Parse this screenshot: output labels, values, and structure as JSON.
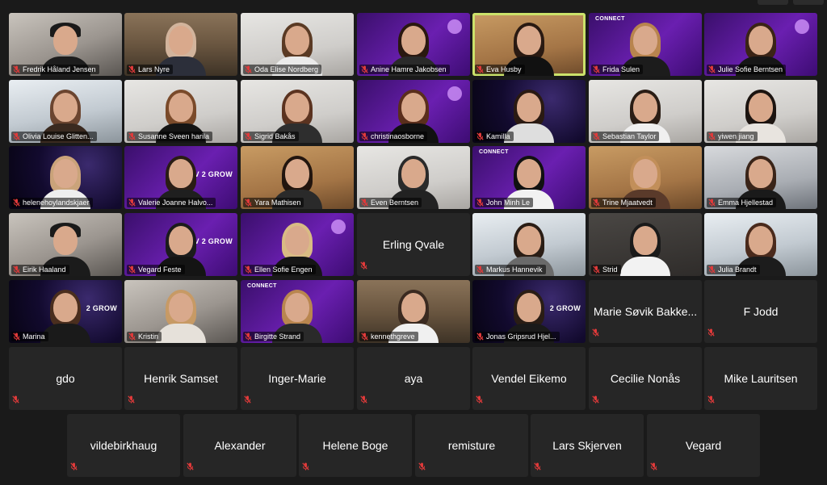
{
  "colors": {
    "background": "#1a1a1a",
    "tile": "#262626",
    "active_border": "#cbe26a",
    "muted_mic": "#e03a3a"
  },
  "icons": {
    "muted": "mic-muted-icon"
  },
  "participants": [
    {
      "name": "Fredrik Håland Jensen",
      "video": true,
      "bg": "room",
      "hair": "#1a1a1a",
      "shirt": "#1d1d1d",
      "cap": true
    },
    {
      "name": "Lars Nyre",
      "video": true,
      "bg": "shelf",
      "hair": "#d2b49c",
      "shirt": "#2c2f3a"
    },
    {
      "name": "Oda Elise Nordberg",
      "video": true,
      "bg": "light",
      "hair": "#5a3a24",
      "shirt": "#eaeaea"
    },
    {
      "name": "Anine Hamre Jakobsen",
      "video": true,
      "bg": "purple",
      "hair": "#2a1810",
      "shirt": "#2a2a2a",
      "mascot": true
    },
    {
      "name": "Eva Husby",
      "video": true,
      "bg": "warm",
      "hair": "#2a1a12",
      "shirt": "#111111",
      "active": true
    },
    {
      "name": "Frida Sulen",
      "video": true,
      "bg": "purple",
      "hair": "#b8844e",
      "shirt": "#1c1c1c",
      "brand": "CONNECT"
    },
    {
      "name": "Julie Sofie Berntsen",
      "video": true,
      "bg": "purple",
      "hair": "#3b2416",
      "shirt": "#161616",
      "mascot": true
    },
    {
      "name": "Olivia Louise Glitten...",
      "video": true,
      "bg": "window",
      "hair": "#6b4530",
      "shirt": "#3a2a20"
    },
    {
      "name": "Susanne Sveen harila",
      "video": true,
      "bg": "light",
      "hair": "#7a4a2a",
      "shirt": "#141414"
    },
    {
      "name": "Sigrid Bakås",
      "video": true,
      "bg": "light",
      "hair": "#5b3320",
      "shirt": "#2e2e2e"
    },
    {
      "name": "christinaosborne",
      "video": true,
      "bg": "purple",
      "hair": "#5a2e1c",
      "shirt": "#111111",
      "mascot": true
    },
    {
      "name": "Kamilla",
      "video": true,
      "bg": "space",
      "hair": "#2a1a12",
      "shirt": "#dedede"
    },
    {
      "name": "Sebastian Taylor",
      "video": true,
      "bg": "light",
      "hair": "#2a1d15",
      "shirt": "#f0f0f0"
    },
    {
      "name": "yiwen jiang",
      "video": true,
      "bg": "light",
      "hair": "#1c1410",
      "shirt": "#e8e4df"
    },
    {
      "name": "helenehoylandskjaer",
      "video": true,
      "bg": "space",
      "hair": "#caa37a",
      "shirt": "#eeeeee"
    },
    {
      "name": "Valerie Joanne Halvo...",
      "video": true,
      "bg": "purple",
      "hair": "#2a1d15",
      "shirt": "#1f1f1f",
      "brand": "V 2 GROW"
    },
    {
      "name": "Yara Mathisen",
      "video": true,
      "bg": "warm",
      "hair": "#22150e",
      "shirt": "#2a2a2a"
    },
    {
      "name": "Even Berntsen",
      "video": true,
      "bg": "light",
      "hair": "#2a2a2a",
      "shirt": "#222222"
    },
    {
      "name": "John Minh Le",
      "video": true,
      "bg": "purple",
      "hair": "#111111",
      "shirt": "#f2f2f2",
      "brand": "CONNECT"
    },
    {
      "name": "Trine Mjaatvedt",
      "video": true,
      "bg": "warm",
      "hair": "#c28f5a",
      "shirt": "#5a3a2a"
    },
    {
      "name": "Emma Hjellestad",
      "video": true,
      "bg": "office",
      "hair": "#3a2418",
      "shirt": "#1a1a1a"
    },
    {
      "name": "Eirik Haaland",
      "video": true,
      "bg": "room",
      "hair": "#1a1a1a",
      "shirt": "#1b1b1b",
      "cap": true
    },
    {
      "name": "Vegard Feste",
      "video": true,
      "bg": "purple",
      "hair": "#1c1c1c",
      "shirt": "#141414",
      "brand": "V 2 GROW"
    },
    {
      "name": "Ellen Sofie Engen",
      "video": true,
      "bg": "purple",
      "hair": "#d9bb84",
      "shirt": "#151515",
      "mascot": true
    },
    {
      "name": "Erling Qvale",
      "video": false
    },
    {
      "name": "Markus Hannevik",
      "video": true,
      "bg": "window",
      "hair": "#2a1d15",
      "shirt": "#6a6a6a"
    },
    {
      "name": "Strid",
      "video": true,
      "bg": "dark",
      "hair": "#1a1a1a",
      "shirt": "#f2f2f2"
    },
    {
      "name": "Julia Brandt",
      "video": true,
      "bg": "window",
      "hair": "#4a2a1c",
      "shirt": "#1c1c1c"
    },
    {
      "name": "Marina",
      "video": true,
      "bg": "space",
      "hair": "#4a2e1e",
      "shirt": "#1a1a1a",
      "brand": "2 GROW"
    },
    {
      "name": "Kristin",
      "video": true,
      "bg": "room",
      "hair": "#c79a65",
      "shirt": "#e6e1da"
    },
    {
      "name": "Birgitte Strand",
      "video": true,
      "bg": "purple",
      "hair": "#b9864f",
      "shirt": "#2a2a2a",
      "brand": "CONNECT"
    },
    {
      "name": "kennethgreve",
      "video": true,
      "bg": "shelf",
      "hair": "#3a2a20",
      "shirt": "#f0f0f0"
    },
    {
      "name": "Jonas Gripsrud Hjel...",
      "video": true,
      "bg": "space",
      "hair": "#2a1d15",
      "shirt": "#1a1a1a",
      "brand": "2 GROW"
    },
    {
      "name": "Marie Søvik Bakke...",
      "video": false
    },
    {
      "name": "F Jodd",
      "video": false
    },
    {
      "name": "gdo",
      "video": false
    },
    {
      "name": "Henrik Samset",
      "video": false
    },
    {
      "name": "Inger-Marie",
      "video": false
    },
    {
      "name": "aya",
      "video": false
    },
    {
      "name": "Vendel Eikemo",
      "video": false
    },
    {
      "name": "Cecilie Nonås",
      "video": false
    },
    {
      "name": "Mike Lauritsen",
      "video": false
    },
    {
      "name": "vildebirkhaug",
      "video": false
    },
    {
      "name": "Alexander",
      "video": false
    },
    {
      "name": "Helene Boge",
      "video": false
    },
    {
      "name": "remisture",
      "video": false
    },
    {
      "name": "Lars Skjerven",
      "video": false
    },
    {
      "name": "Vegard",
      "video": false
    }
  ]
}
